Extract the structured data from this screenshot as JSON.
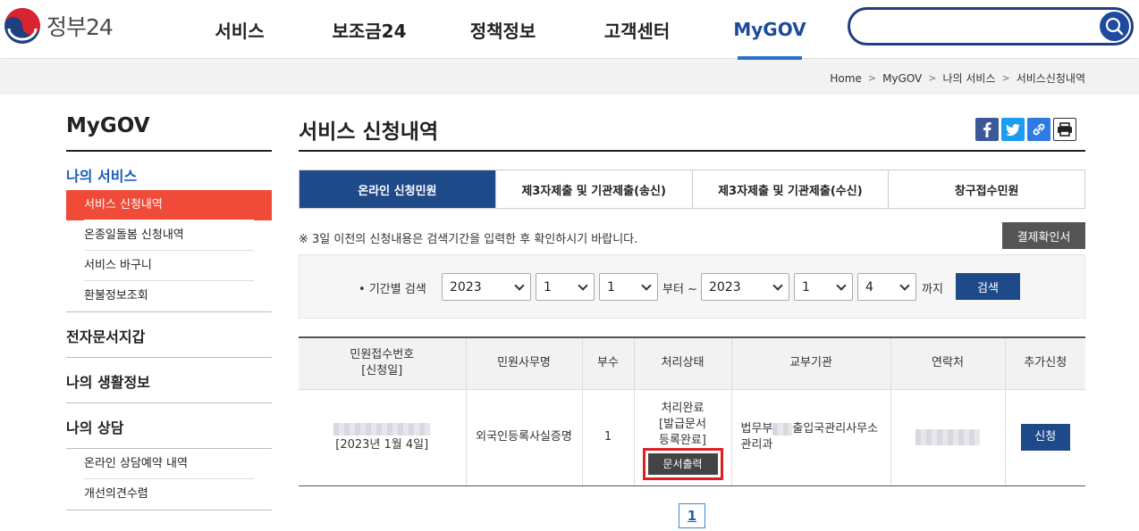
{
  "header": {
    "logo_text": "정부24",
    "logo_icon": "taegeuk-icon",
    "nav": [
      {
        "label": "서비스"
      },
      {
        "label": "보조금24"
      },
      {
        "label": "정책정보"
      },
      {
        "label": "고객센터"
      },
      {
        "label": "MyGOV",
        "active": true
      }
    ],
    "search": {
      "placeholder": "",
      "icon": "search-icon"
    }
  },
  "breadcrumb": [
    "Home",
    "MyGOV",
    "나의 서비스",
    "서비스신청내역"
  ],
  "sidebar": {
    "title": "MyGOV",
    "groups": [
      {
        "title": "나의 서비스",
        "items": [
          "서비스 신청내역",
          "온종일돌봄 신청내역",
          "서비스 바구니",
          "환불정보조회"
        ]
      },
      {
        "title": "전자문서지갑"
      },
      {
        "title": "나의 생활정보"
      },
      {
        "title": "나의 상담",
        "items": [
          "온라인 상담예약 내역",
          "개선의견수렴"
        ]
      }
    ]
  },
  "content": {
    "title": "서비스 신청내역",
    "share_icons": [
      "facebook-icon",
      "twitter-icon",
      "link-icon",
      "print-icon"
    ],
    "tabs": [
      "온라인 신청민원",
      "제3자제출 및 기관제출(송신)",
      "제3자제출 및 기관제출(수신)",
      "창구접수민원"
    ],
    "notice": "※ 3일 이전의 신청내용은 검색기간을 입력한 후 확인하시기 바랍니다.",
    "receipt_button": "결제확인서",
    "search": {
      "label": "기간별 검색",
      "from": {
        "year": "2023",
        "month": "1",
        "day": "1"
      },
      "from_suffix": "부터 ~",
      "to": {
        "year": "2023",
        "month": "1",
        "day": "4"
      },
      "to_suffix": "까지",
      "button": "검색"
    },
    "table": {
      "headers": [
        "민원접수번호",
        "[신청일]",
        "민원사무명",
        "부수",
        "처리상태",
        "교부기관",
        "연락처",
        "추가신청"
      ],
      "rows": [
        {
          "date": "[2023년 1월 4일]",
          "service": "외국인등록사실증명",
          "copies": "1",
          "status_1": "처리완료",
          "status_2": "[발급문서",
          "status_3": "등록완료]",
          "print_button": "문서출력",
          "agency_1": "법무부",
          "agency_2": "출입국관리사무소",
          "agency_3": "관리과",
          "apply_button": "신청"
        }
      ]
    },
    "pagination": {
      "current": "1"
    }
  }
}
